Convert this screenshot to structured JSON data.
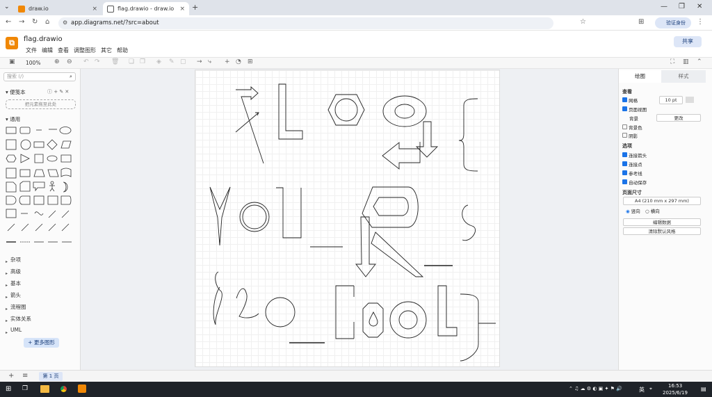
{
  "browser": {
    "tabs": [
      {
        "title": "draw.io"
      },
      {
        "title": "flag.drawio - draw.io"
      }
    ],
    "new_tab": "+",
    "url": "app.diagrams.net/?src=about",
    "profile": "验证身份"
  },
  "app": {
    "doc_name": "flag.drawio",
    "menus": [
      "文件",
      "编辑",
      "查看",
      "调整图形",
      "其它",
      "帮助"
    ],
    "share": "共享",
    "zoom": "100%"
  },
  "left_panel": {
    "search_placeholder": "搜索 (/)",
    "scratchpad": "便笺本",
    "drop_hint": "把元素拖至此处",
    "general": "通用",
    "categories": [
      "杂项",
      "高级",
      "基本",
      "箭头",
      "流程图",
      "实体关系",
      "UML"
    ],
    "more_shapes": "+ 更多图形"
  },
  "right_panel": {
    "tab_diagram": "绘图",
    "tab_style": "样式",
    "view": "查看",
    "grid": "网格",
    "grid_size": "10 pt",
    "page_view": "页面视图",
    "background": "背景",
    "change": "更改",
    "bg_color": "背景色",
    "shadow": "阴影",
    "options": "选项",
    "connection_arrows": "连接箭头",
    "connection_points": "连接点",
    "guides": "参考线",
    "autosave": "自动保存",
    "paper_size": "页面尺寸",
    "paper_value": "A4 (210 mm x 297 mm)",
    "portrait": "竖向",
    "landscape": "横向",
    "edit_data": "编辑数据",
    "clear_style": "清除默认风格"
  },
  "footer": {
    "page_tab": "第 1 页"
  },
  "taskbar": {
    "time": "16:53",
    "date": "2025/6/19",
    "ime": "英"
  },
  "colors": {
    "accent": "#1a73e8",
    "drawio": "#f08705",
    "taskbar": "#1f2329"
  }
}
